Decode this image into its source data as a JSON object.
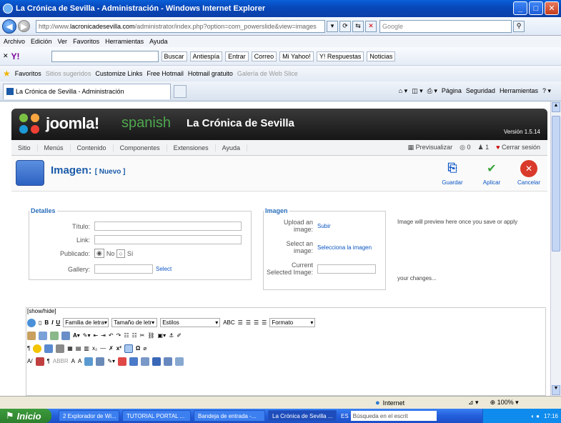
{
  "window": {
    "title": "La Crónica de Sevilla - Administración - Windows Internet Explorer"
  },
  "address": {
    "url_prefix": "http://www.",
    "url_domain": "lacronicadesevilla.com",
    "url_path": "/administrator/index.php?option=com_powerslide&view=images",
    "search_placeholder": "Google"
  },
  "menubar": [
    "Archivo",
    "Edición",
    "Ver",
    "Favoritos",
    "Herramientas",
    "Ayuda"
  ],
  "yahoo_toolbar": {
    "buscar": "Buscar",
    "items": [
      "Antiespía",
      "Entrar",
      "Correo",
      "Mi Yahoo!",
      "Y! Respuestas",
      "Noticias"
    ]
  },
  "favorites": {
    "label": "Favoritos",
    "items": [
      "Sitios sugeridos",
      "Customize Links",
      "Free Hotmail",
      "Hotmail gratuito",
      "Galería de Web Slice"
    ]
  },
  "tab": {
    "title": "La Crónica de Sevilla - Administración",
    "commands": [
      "Página",
      "Seguridad",
      "Herramientas"
    ]
  },
  "joomla": {
    "brand": "joomla!",
    "spanish": "spanish",
    "site": "La Crónica de Sevilla",
    "version": "Versión 1.5.14",
    "menu": [
      "Sitio",
      "Menús",
      "Contenido",
      "Componentes",
      "Extensiones",
      "Ayuda"
    ],
    "preview": "Previsualizar",
    "count_messages": "0",
    "count_users": "1",
    "logout": "Cerrar sesión"
  },
  "toolbar": {
    "title": "Imagen:",
    "subtitle": "[ Nuevo ]",
    "save": "Guardar",
    "apply": "Aplicar",
    "cancel": "Cancelar"
  },
  "details": {
    "legend": "Detalles",
    "title_label": "Título:",
    "link_label": "Link:",
    "published_label": "Publicado:",
    "no_label": "No",
    "yes_label": "Sí",
    "gallery_label": "Gallery:",
    "select_label": "Select"
  },
  "image": {
    "legend": "Imagen",
    "upload_label": "Upload an image:",
    "upload_link": "Subir",
    "select_label": "Select an image:",
    "select_link": "Selecciona la imagen",
    "current_label": "Current Selected Image:",
    "preview_text1": "Image will preview here once you save or apply",
    "preview_text2": "your changes..."
  },
  "editor": {
    "showhide": "[show/hide]",
    "font_family": "Familia de letra",
    "font_size": "Tamaño de letr",
    "styles": "Estilos",
    "format": "Formato"
  },
  "status": {
    "zone": "Internet",
    "zoom": "100%"
  },
  "taskbar": {
    "start": "Inicio",
    "tasks": [
      "2 Explorador de Wi...",
      "TUTORIAL PORTAL ...",
      "Bandeja de entrada -...",
      "La Crónica de Sevilla ..."
    ],
    "search": "Búsqueda en el escrit",
    "lang": "ES",
    "time": "17:16"
  }
}
